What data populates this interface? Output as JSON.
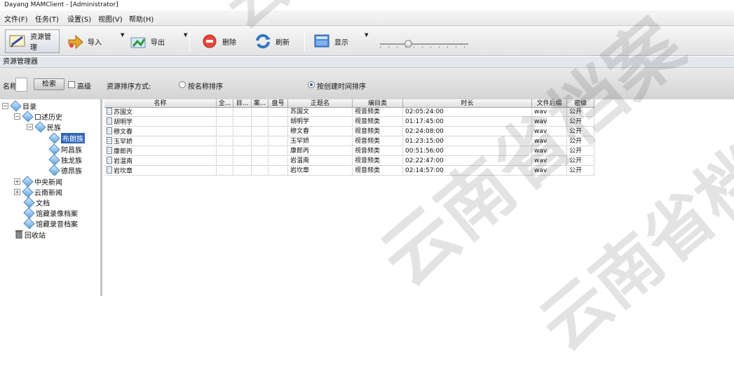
{
  "window": {
    "title": "Dayang MAMClient - [Administrator]"
  },
  "menu": [
    "文件(F)",
    "任务(T)",
    "设置(S)",
    "视图(V)",
    "帮助(H)"
  ],
  "toolbar": {
    "buttons": [
      {
        "label": "资源管理",
        "icon": "resource-manager-icon"
      },
      {
        "label": "导入",
        "icon": "import-arrow-icon"
      },
      {
        "label": "导出",
        "icon": "export-arrow-icon"
      },
      {
        "label": "删除",
        "icon": "delete-icon"
      },
      {
        "label": "刷新",
        "icon": "refresh-icon"
      },
      {
        "label": "显示",
        "icon": "display-icon"
      }
    ],
    "dropdown_arrow": "▼"
  },
  "panel": {
    "title": "资源管理器"
  },
  "filter": {
    "name_label": "名称",
    "search_label": "检索",
    "advanced_label": "高级",
    "sort_label": "资源排序方式:",
    "sort_by_name": "按名称排序",
    "sort_by_time": "按创建时间排序",
    "selected_sort": "按创建时间排序"
  },
  "tree": [
    {
      "label": "目录",
      "level": 0,
      "expander": "−",
      "icon": "folder-diamond-icon"
    },
    {
      "label": "口述历史",
      "level": 1,
      "expander": "−",
      "icon": "folder-diamond-icon"
    },
    {
      "label": "民族",
      "level": 2,
      "expander": "−",
      "icon": "folder-diamond-icon"
    },
    {
      "label": "布朗族",
      "level": 3,
      "expander": "",
      "icon": "folder-diamond-icon",
      "selected": true
    },
    {
      "label": "阿昌族",
      "level": 3,
      "expander": "",
      "icon": "folder-diamond-icon"
    },
    {
      "label": "独龙族",
      "level": 3,
      "expander": "",
      "icon": "folder-diamond-icon"
    },
    {
      "label": "德昂族",
      "level": 3,
      "expander": "",
      "icon": "folder-diamond-icon"
    },
    {
      "label": "中央新闻",
      "level": 1,
      "expander": "+",
      "icon": "folder-diamond-icon"
    },
    {
      "label": "云南新闻",
      "level": 1,
      "expander": "+",
      "icon": "folder-diamond-icon"
    },
    {
      "label": "文档",
      "level": 1,
      "expander": "",
      "icon": "folder-diamond-icon"
    },
    {
      "label": "馆藏录像档案",
      "level": 1,
      "expander": "",
      "icon": "folder-diamond-icon"
    },
    {
      "label": "馆藏录音档案",
      "level": 1,
      "expander": "",
      "icon": "folder-diamond-icon"
    },
    {
      "label": "回收站",
      "level": 0,
      "expander": "",
      "icon": "recycle-bin-icon"
    }
  ],
  "table": {
    "columns": [
      "名称",
      "全...",
      "目...",
      "案...",
      "盘号",
      "正题名",
      "编目类",
      "时长",
      "文件后缀",
      "密级"
    ],
    "rows": [
      [
        "苏国文",
        "",
        "",
        "",
        "",
        "苏国文",
        "视音频类",
        "02:05:24:00",
        "wav",
        "公开"
      ],
      [
        "胡明学",
        "",
        "",
        "",
        "",
        "胡明学",
        "视音频类",
        "01:17:45:00",
        "wav",
        "公开"
      ],
      [
        "穆文春",
        "",
        "",
        "",
        "",
        "穆文春",
        "视音频类",
        "02:24:08:00",
        "wav",
        "公开"
      ],
      [
        "玉罕娇",
        "",
        "",
        "",
        "",
        "玉罕娇",
        "视音频类",
        "01:23:15:00",
        "wav",
        "公开"
      ],
      [
        "康郎丙",
        "",
        "",
        "",
        "",
        "康郎丙",
        "视音频类",
        "00:51:56:00",
        "wav",
        "公开"
      ],
      [
        "岩温南",
        "",
        "",
        "",
        "",
        "岩温南",
        "视音频类",
        "02:22:47:00",
        "wav",
        "公开"
      ],
      [
        "岩坎章",
        "",
        "",
        "",
        "",
        "岩坎章",
        "视音频类",
        "02:14:57:00",
        "wav",
        "公开"
      ]
    ]
  },
  "watermark": {
    "text": "云南省档案"
  },
  "colors": {
    "selection": "#3166b8",
    "grid_line": "#d7d7d7",
    "toolbar_bg": "#e3e3e3"
  }
}
